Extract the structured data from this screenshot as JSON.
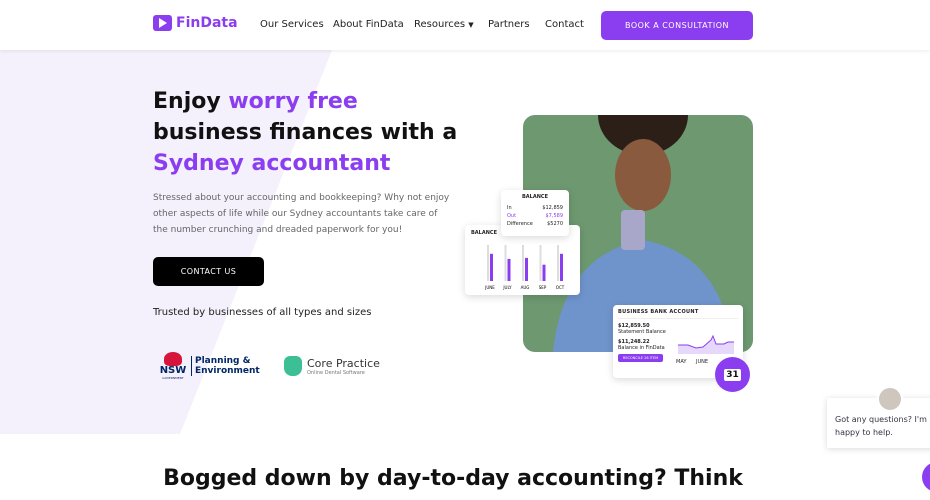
{
  "nav": {
    "brand": "FinData",
    "items": [
      "Our Services",
      "About FinData",
      "Resources",
      "Partners",
      "Contact"
    ],
    "cta": "BOOK A CONSULTATION"
  },
  "hero": {
    "title_1": "Enjoy ",
    "title_2": "worry free",
    "title_3": " business finances with a ",
    "title_4": "Sydney accountant",
    "lead": "Stressed about your accounting and bookkeeping? Why not enjoy other aspects of life while our Sydney accountants take care of the number crunching and dreaded paperwork for you!",
    "contact": "CONTACT US",
    "trusted": "Trusted by businesses of all types and sizes"
  },
  "logos": {
    "nsw": "NSW",
    "nsw_sub": "GOVERNMENT",
    "planning_1": "Planning &",
    "planning_2": "Environment",
    "core": "Core Practice",
    "core_sub": "Online Dental Software"
  },
  "balance_popup": {
    "title": "BALANCE",
    "rows": [
      {
        "label": "In",
        "value": "$12,859"
      },
      {
        "label": "Out",
        "value": "$7,589"
      },
      {
        "label": "Difference",
        "value": "$5270"
      }
    ]
  },
  "balance_chart": {
    "title": "BALANCE",
    "months": [
      "JUNE",
      "JULY",
      "AUG",
      "SEP",
      "OCT"
    ],
    "values": [
      0.8,
      0.65,
      0.68,
      0.48,
      0.8
    ]
  },
  "bank": {
    "title": "BUSINESS BANK ACCOUNT",
    "statement_value": "$12,859.50",
    "statement_label": "Statement Balance",
    "findata_value": "$11,248.22",
    "findata_label": "Balance in FinData",
    "button": "RECONCILE 26 ITEM",
    "months": [
      "MAY",
      "JUNE"
    ]
  },
  "calendar": "31",
  "chat": "Got any questions? I'm happy to help.",
  "section_heading": "Bogged down by day-to-day accounting? Think",
  "colors": {
    "accent": "#8b3df0",
    "photo_bg": "#6d9870"
  }
}
